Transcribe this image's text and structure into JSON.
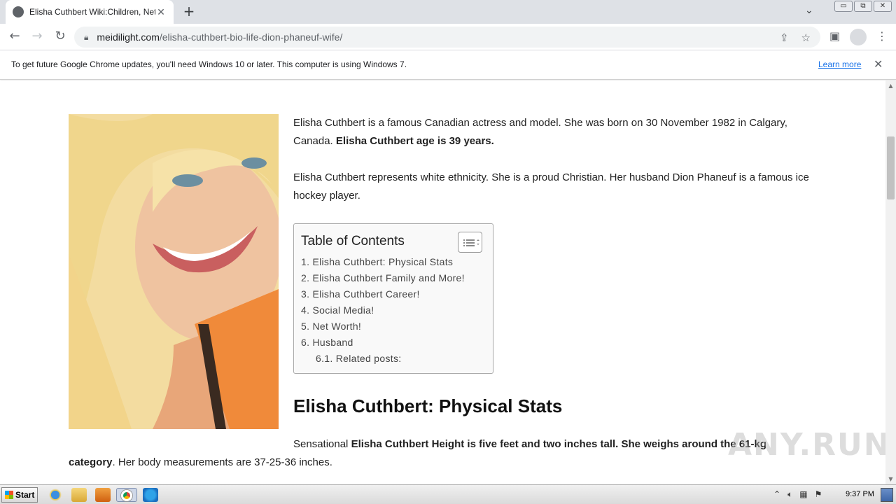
{
  "browser": {
    "tab_title": "Elisha Cuthbert Wiki:Children, Net W",
    "tab_close": "✕",
    "new_tab": "+",
    "url_host": "meidilight.com",
    "url_path": "/elisha-cuthbert-bio-life-dion-phaneuf-wife/",
    "window_buttons": [
      "▭",
      "⧉",
      "✕"
    ]
  },
  "infobar": {
    "message": "To get future Google Chrome updates, you'll need Windows 10 or later. This computer is using Windows 7.",
    "learn_more": "Learn more",
    "close": "✕"
  },
  "article": {
    "p1_a": "Elisha Cuthbert is a famous Canadian actress and model. She was born on 30 November 1982 in Calgary, Canada. ",
    "p1_b": "Elisha Cuthbert age is 39 years.",
    "p2": "Elisha Cuthbert represents white ethnicity. She is a proud Christian. Her husband Dion Phaneuf is a famous ice hockey player.",
    "toc_title": "Table of Contents",
    "toc_items": [
      "1. Elisha Cuthbert: Physical Stats",
      "2. Elisha Cuthbert Family and More!",
      "3. Elisha Cuthbert Career!",
      "4. Social Media!",
      "5. Net Worth!",
      "6. Husband",
      "6.1. Related posts:"
    ],
    "heading": "Elisha Cuthbert: Physical Stats",
    "p3_a": "Sensational ",
    "p3_b": "Elisha Cuthbert Height is five feet and two inches tall. She weighs around the 61-kg category",
    "p3_c": ". Her body measurements are 37-25-36 inches."
  },
  "watermark": "ANY.RUN",
  "taskbar": {
    "start": "Start",
    "clock": "9:37 PM"
  },
  "colors": {
    "link": "#1a73e8",
    "tab_strip": "#dee1e6",
    "omnibox": "#f1f3f4"
  }
}
